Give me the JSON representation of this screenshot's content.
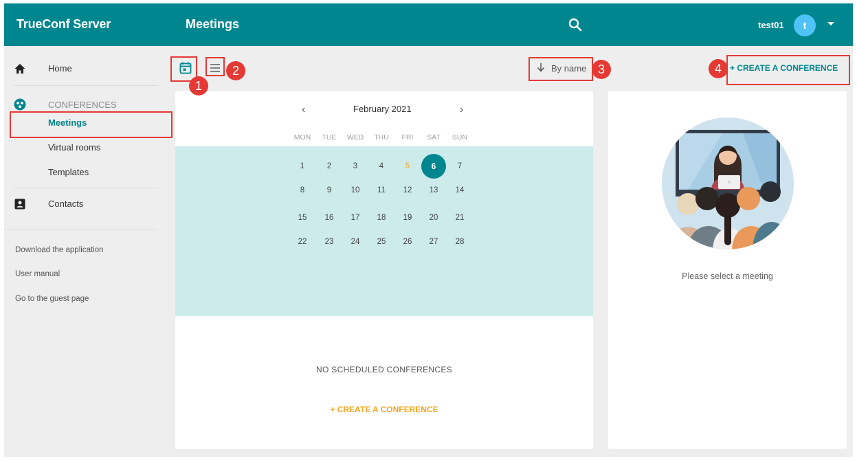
{
  "header": {
    "brand": "TrueConf Server",
    "page_title": "Meetings",
    "username": "test01",
    "avatar_letter": "t"
  },
  "sidebar": {
    "home": "Home",
    "section": "CONFERENCES",
    "items": [
      "Meetings",
      "Virtual rooms",
      "Templates"
    ],
    "active_item": "Meetings",
    "contacts": "Contacts",
    "links": [
      "Download the application",
      "User manual",
      "Go to the guest page"
    ]
  },
  "toolbar": {
    "sort_label": "By name",
    "create_label": "+ CREATE A CONFERENCE"
  },
  "annotations": [
    "1",
    "2",
    "3",
    "4"
  ],
  "calendar": {
    "month_label": "February 2021",
    "weekdays": [
      "MON",
      "TUE",
      "WED",
      "THU",
      "FRI",
      "SAT",
      "SUN"
    ],
    "weeks": [
      [
        "1",
        "2",
        "3",
        "4",
        "5",
        "6",
        "7"
      ],
      [
        "8",
        "9",
        "10",
        "11",
        "12",
        "13",
        "14"
      ],
      [
        "15",
        "16",
        "17",
        "18",
        "19",
        "20",
        "21"
      ],
      [
        "22",
        "23",
        "24",
        "25",
        "26",
        "27",
        "28"
      ]
    ],
    "today": "5",
    "selected": "6"
  },
  "meetings": {
    "empty_label": "NO SCHEDULED CONFERENCES",
    "create_label": "+ CREATE A CONFERENCE"
  },
  "detail": {
    "placeholder": "Please select a meeting"
  },
  "colors": {
    "primary": "#00868f",
    "accent": "#f5a623",
    "annotation": "#e53935",
    "calendar_bg": "#cdebeb"
  }
}
